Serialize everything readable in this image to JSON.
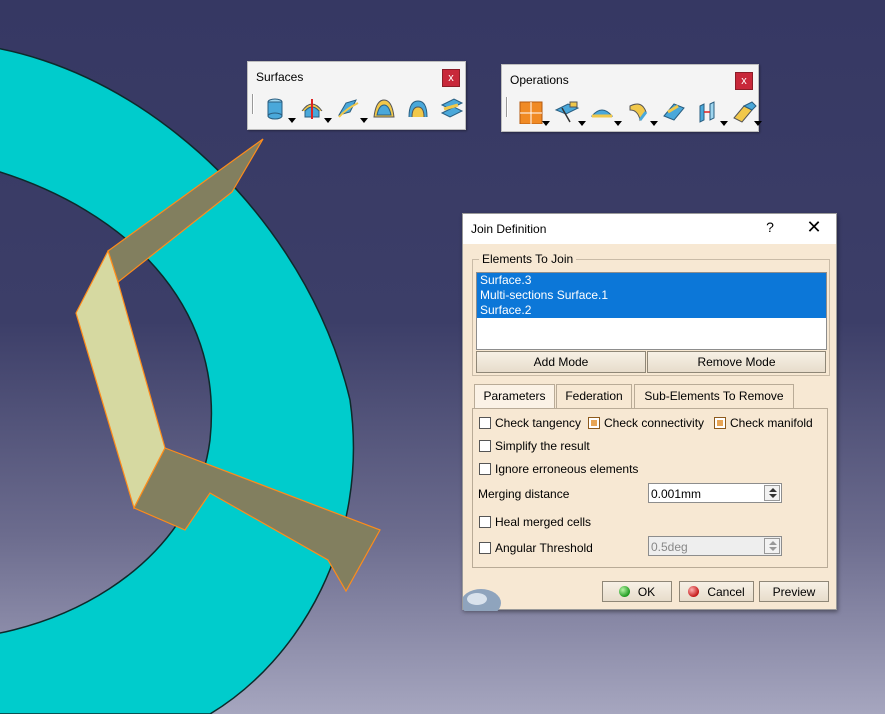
{
  "toolbars": {
    "surfaces": {
      "title": "Surfaces",
      "close_glyph": "x",
      "icons": [
        "extrude-surface-icon",
        "revolve-surface-icon",
        "sweep-surface-icon",
        "fill-surface-icon",
        "multi-sections-surface-icon",
        "blend-surface-icon"
      ]
    },
    "operations": {
      "title": "Operations",
      "close_glyph": "x",
      "icons": [
        "join-icon",
        "split-icon",
        "boundary-icon",
        "extract-icon",
        "fillet-icon",
        "translate-icon",
        "extrapolate-icon"
      ]
    }
  },
  "dialog": {
    "title": "Join Definition",
    "help_glyph": "?",
    "close_glyph": "✕",
    "elements_group_label": "Elements To Join",
    "elements": [
      "Surface.3",
      "Multi-sections Surface.1",
      "Surface.2"
    ],
    "add_mode_label": "Add Mode",
    "remove_mode_label": "Remove Mode",
    "tabs": [
      "Parameters",
      "Federation",
      "Sub-Elements To Remove"
    ],
    "active_tab": "Parameters",
    "check_tangency_label": "Check tangency",
    "check_tangency": false,
    "check_connectivity_label": "Check connectivity",
    "check_connectivity": true,
    "check_manifold_label": "Check manifold",
    "check_manifold": true,
    "simplify_label": "Simplify the result",
    "simplify": false,
    "ignore_label": "Ignore erroneous elements",
    "ignore": false,
    "merging_distance_label": "Merging distance",
    "merging_distance_value": "0.001mm",
    "heal_label": "Heal merged cells",
    "heal": false,
    "angular_label": "Angular Threshold",
    "angular": false,
    "angular_value": "0.5deg",
    "ok_label": "OK",
    "cancel_label": "Cancel",
    "preview_label": "Preview"
  },
  "colors": {
    "surface_cyan": "#00cccc",
    "surface_olive": "#827f5f",
    "surface_pale": "#d6d9a1",
    "highlight_orange": "#ff8c1a",
    "selection_blue": "#0c77d8",
    "dialog_bg": "#f7e8d3"
  }
}
